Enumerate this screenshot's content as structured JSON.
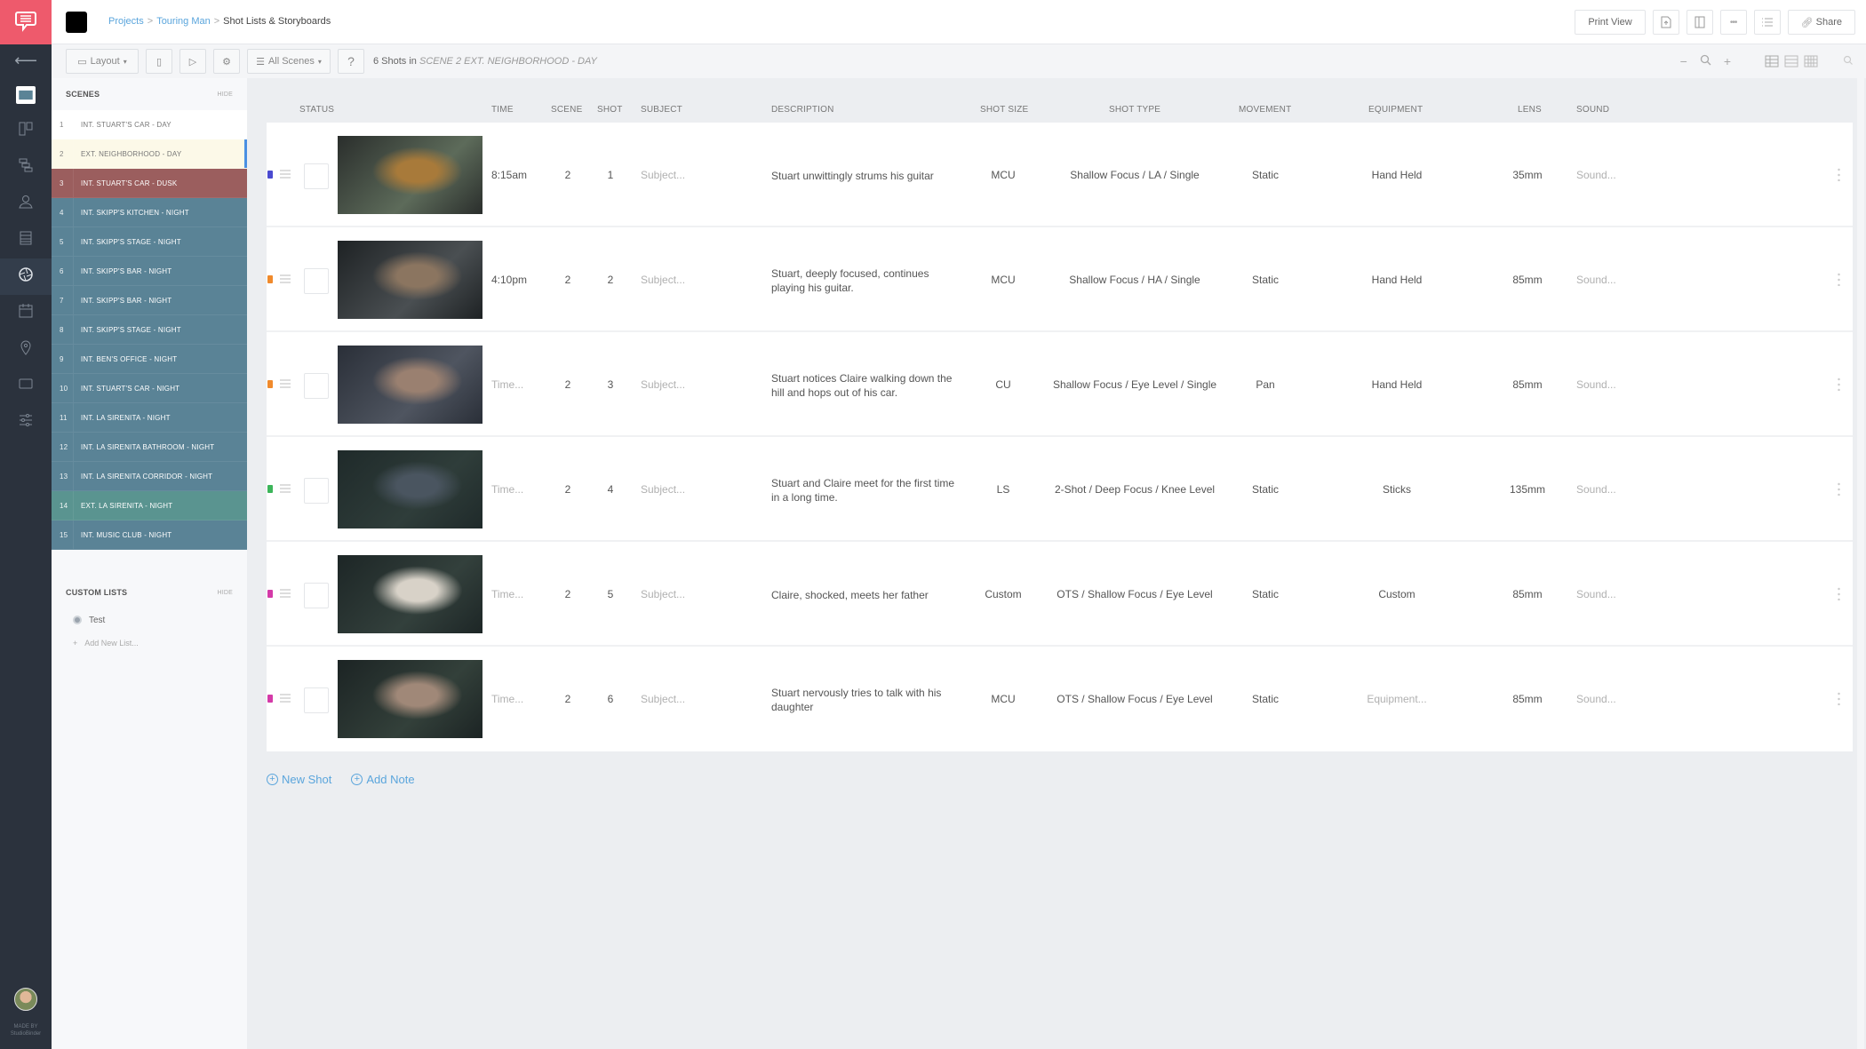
{
  "app": {
    "brand_color": "#ee5a6c",
    "rail_color": "#2b323d",
    "made_by_line1": "MADE BY",
    "made_by_line2": "StudioBinder"
  },
  "rail": {
    "back_icon": "arrow-left-icon",
    "items": [
      {
        "icon": "storyboard-icon",
        "active": false,
        "highlight": true
      },
      {
        "icon": "board-icon",
        "active": false
      },
      {
        "icon": "stripboard-icon",
        "active": false
      },
      {
        "icon": "cast-icon",
        "active": false
      },
      {
        "icon": "list-icon",
        "active": false
      },
      {
        "icon": "shot-list-aperture-icon",
        "active": true
      },
      {
        "icon": "calendar-icon",
        "active": false
      },
      {
        "icon": "location-pin-icon",
        "active": false
      },
      {
        "icon": "screen-icon",
        "active": false
      },
      {
        "icon": "settings-sliders-icon",
        "active": false
      }
    ]
  },
  "breadcrumb": {
    "items": [
      "Projects",
      "Touring Man"
    ],
    "current": "Shot Lists & Storyboards"
  },
  "top_actions": {
    "print_view": "Print View",
    "share": "Share"
  },
  "toolbar": {
    "layout_label": "Layout",
    "scenes_filter": "All Scenes",
    "help": "?",
    "shots_count_prefix": "6 Shots in",
    "shots_count_scene": "SCENE 2 EXT. NEIGHBORHOOD - DAY",
    "zoom_out": "−",
    "zoom_in": "+"
  },
  "scenes_panel": {
    "title": "SCENES",
    "hide_label": "HIDE",
    "scenes": [
      {
        "num": "1",
        "name": "INT. STUART'S CAR - DAY",
        "type": "day"
      },
      {
        "num": "2",
        "name": "EXT. NEIGHBORHOOD - DAY",
        "type": "selected"
      },
      {
        "num": "3",
        "name": "INT. STUART'S CAR - DUSK",
        "type": "dusk"
      },
      {
        "num": "4",
        "name": "INT. SKIPP'S KITCHEN - NIGHT",
        "type": "night"
      },
      {
        "num": "5",
        "name": "INT. SKIPP'S STAGE - NIGHT",
        "type": "night"
      },
      {
        "num": "6",
        "name": "INT. SKIPP'S BAR - NIGHT",
        "type": "night"
      },
      {
        "num": "7",
        "name": "INT. SKIPP'S BAR - NIGHT",
        "type": "night"
      },
      {
        "num": "8",
        "name": "INT. SKIPP'S STAGE - NIGHT",
        "type": "night"
      },
      {
        "num": "9",
        "name": "INT. BEN'S OFFICE - NIGHT",
        "type": "night"
      },
      {
        "num": "10",
        "name": "INT. STUART'S CAR - NIGHT",
        "type": "night"
      },
      {
        "num": "11",
        "name": "INT. LA SIRENITA - NIGHT",
        "type": "night"
      },
      {
        "num": "12",
        "name": "INT. LA SIRENITA BATHROOM - NIGHT",
        "type": "night"
      },
      {
        "num": "13",
        "name": "INT. LA SIRENITA CORRIDOR - NIGHT",
        "type": "night"
      },
      {
        "num": "14",
        "name": "EXT. LA SIRENITA - NIGHT",
        "type": "ext-night"
      },
      {
        "num": "15",
        "name": "INT. MUSIC CLUB - NIGHT",
        "type": "night"
      }
    ],
    "custom_lists_title": "CUSTOM LISTS",
    "custom_lists_hide": "HIDE",
    "custom_lists": [
      "Test"
    ],
    "add_new_list": "Add New List..."
  },
  "table": {
    "columns": [
      "STATUS",
      "TIME",
      "SCENE",
      "SHOT",
      "SUBJECT",
      "DESCRIPTION",
      "SHOT SIZE",
      "SHOT TYPE",
      "MOVEMENT",
      "EQUIPMENT",
      "LENS",
      "SOUND"
    ],
    "rows": [
      {
        "status_color": "#4a4ad0",
        "time": "8:15am",
        "time_ph": false,
        "scene": "2",
        "shot": "1",
        "subject": "Subject...",
        "description": "Stuart unwittingly strums his guitar",
        "shot_size": "MCU",
        "shot_type": "Shallow Focus / LA / Single",
        "movement": "Static",
        "equipment": "Hand Held",
        "equipment_ph": false,
        "lens": "35mm",
        "sound": "Sound...",
        "thumb": [
          "#2a2e2c",
          "#5d6b5a",
          "#a87a3a"
        ]
      },
      {
        "status_color": "#f08a2c",
        "time": "4:10pm",
        "time_ph": false,
        "scene": "2",
        "shot": "2",
        "subject": "Subject...",
        "description": "Stuart, deeply focused, continues playing his guitar.",
        "shot_size": "MCU",
        "shot_type": "Shallow Focus / HA / Single",
        "movement": "Static",
        "equipment": "Hand Held",
        "equipment_ph": false,
        "lens": "85mm",
        "sound": "Sound...",
        "thumb": [
          "#1e2224",
          "#4a4f52",
          "#8b7560"
        ]
      },
      {
        "status_color": "#f08a2c",
        "time": "Time...",
        "time_ph": true,
        "scene": "2",
        "shot": "3",
        "subject": "Subject...",
        "description": "Stuart notices Claire walking down the hill and hops out of his car.",
        "shot_size": "CU",
        "shot_type": "Shallow Focus / Eye Level / Single",
        "movement": "Pan",
        "equipment": "Hand Held",
        "equipment_ph": false,
        "lens": "85mm",
        "sound": "Sound...",
        "thumb": [
          "#2a2f38",
          "#4f5560",
          "#9a8070"
        ]
      },
      {
        "status_color": "#3cb55a",
        "time": "Time...",
        "time_ph": true,
        "scene": "2",
        "shot": "4",
        "subject": "Subject...",
        "description": "Stuart and Claire meet for the first time in a long time.",
        "shot_size": "LS",
        "shot_type": "2-Shot / Deep Focus / Knee Level",
        "movement": "Static",
        "equipment": "Sticks",
        "equipment_ph": false,
        "lens": "135mm",
        "sound": "Sound...",
        "thumb": [
          "#1f2a2a",
          "#2f3d3a",
          "#4a5560"
        ]
      },
      {
        "status_color": "#d43aa8",
        "time": "Time...",
        "time_ph": true,
        "scene": "2",
        "shot": "5",
        "subject": "Subject...",
        "description": "Claire, shocked, meets her father",
        "shot_size": "Custom",
        "shot_type": "OTS / Shallow Focus / Eye Level",
        "movement": "Static",
        "equipment": "Custom",
        "equipment_ph": false,
        "lens": "85mm",
        "sound": "Sound...",
        "thumb": [
          "#1d2626",
          "#33403c",
          "#d8d2c8"
        ]
      },
      {
        "status_color": "#d43aa8",
        "time": "Time...",
        "time_ph": true,
        "scene": "2",
        "shot": "6",
        "subject": "Subject...",
        "description": "Stuart nervously tries to talk with his daughter",
        "shot_size": "MCU",
        "shot_type": "OTS / Shallow Focus / Eye Level",
        "movement": "Static",
        "equipment": "Equipment...",
        "equipment_ph": true,
        "lens": "85mm",
        "sound": "Sound...",
        "thumb": [
          "#1c2424",
          "#33403a",
          "#a08878"
        ]
      }
    ]
  },
  "footer_actions": {
    "new_shot": "New Shot",
    "add_note": "Add Note"
  }
}
